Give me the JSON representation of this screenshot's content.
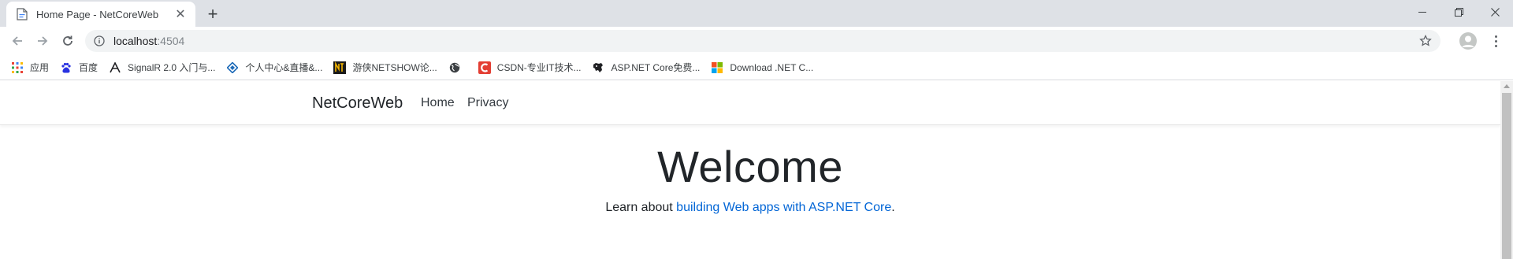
{
  "browser": {
    "tab": {
      "title": "Home Page - NetCoreWeb",
      "close_glyph": "✕",
      "favicon": "page-icon"
    },
    "new_tab_glyph": "+",
    "window_controls": {
      "minimize": "minimize-icon",
      "restore": "restore-icon",
      "close": "close-icon"
    },
    "toolbar": {
      "url_host": "localhost",
      "url_port": ":4504",
      "icons": [
        "back-icon",
        "forward-icon",
        "reload-icon",
        "info-icon",
        "star-icon",
        "profile-icon",
        "menu-icon"
      ]
    },
    "bookmarks": [
      {
        "label": "应用",
        "icon": "apps-icon"
      },
      {
        "label": "百度",
        "icon": "baidu-icon"
      },
      {
        "label": "SignalR 2.0 入门与...",
        "icon": "signalr-icon"
      },
      {
        "label": "个人中心&直播&...",
        "icon": "diamond-icon"
      },
      {
        "label": "游侠NETSHOW论...",
        "icon": "netshow-icon"
      },
      {
        "label": "",
        "icon": "globe-icon"
      },
      {
        "label": "CSDN-专业IT技术...",
        "icon": "csdn-icon"
      },
      {
        "label": "ASP.NET Core免费...",
        "icon": "aspnet-icon"
      },
      {
        "label": "Download .NET C...",
        "icon": "microsoft-icon"
      }
    ]
  },
  "page": {
    "brand": "NetCoreWeb",
    "nav": {
      "home": "Home",
      "privacy": "Privacy"
    },
    "heading": "Welcome",
    "lead_prefix": "Learn about ",
    "lead_link": "building Web apps with ASP.NET Core",
    "lead_suffix": "."
  },
  "colors": {
    "tabstrip_bg": "#dee1e6",
    "link": "#0366d6",
    "text": "#212529"
  }
}
